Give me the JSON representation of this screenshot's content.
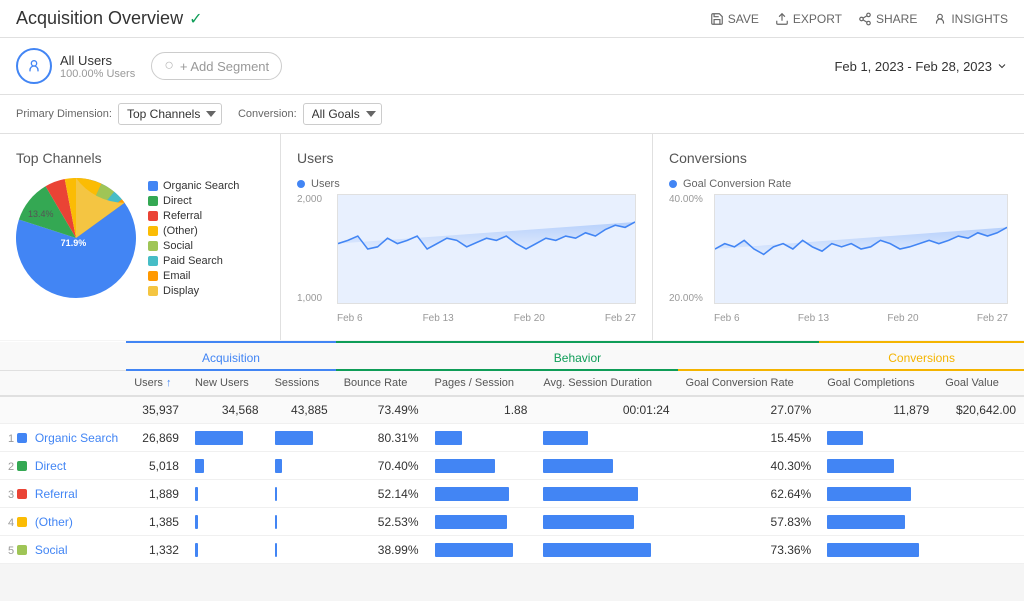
{
  "header": {
    "title": "Acquisition Overview",
    "verified_icon": "✓",
    "actions": [
      {
        "label": "SAVE",
        "icon": "💾"
      },
      {
        "label": "EXPORT",
        "icon": "↑"
      },
      {
        "label": "SHARE",
        "icon": "⇗"
      },
      {
        "label": "INSIGHTS",
        "icon": "👤"
      }
    ]
  },
  "segment": {
    "name": "All Users",
    "sub": "100.00% Users",
    "add_label": "+ Add Segment"
  },
  "date_range": "Feb 1, 2023 - Feb 28, 2023",
  "controls": {
    "primary_dimension_label": "Primary Dimension:",
    "primary_dimension_value": "Top Channels",
    "conversion_label": "Conversion:",
    "conversion_value": "All Goals"
  },
  "top_channels_chart": {
    "title": "Top Channels",
    "legend": [
      {
        "label": "Organic Search",
        "color": "#4285f4"
      },
      {
        "label": "Direct",
        "color": "#34a853"
      },
      {
        "label": "Referral",
        "color": "#ea4335"
      },
      {
        "label": "(Other)",
        "color": "#fbbc04"
      },
      {
        "label": "Social",
        "color": "#9fc556"
      },
      {
        "label": "Paid Search",
        "color": "#46bdc6"
      },
      {
        "label": "Email",
        "color": "#ff9900"
      },
      {
        "label": "Display",
        "color": "#f4c542"
      }
    ],
    "slices": [
      {
        "label": "Organic Search",
        "pct": 71.9,
        "color": "#4285f4",
        "startAngle": 0,
        "endAngle": 258.8
      },
      {
        "label": "Direct",
        "pct": 9.5,
        "color": "#34a853",
        "startAngle": 258.8,
        "endAngle": 293
      },
      {
        "label": "Referral",
        "pct": 5.5,
        "color": "#ea4335",
        "startAngle": 293,
        "endAngle": 312.8
      },
      {
        "label": "(Other)",
        "pct": 4.1,
        "color": "#fbbc04",
        "startAngle": 312.8,
        "endAngle": 327.6
      },
      {
        "label": "Social",
        "pct": 3.8,
        "color": "#9fc556",
        "startAngle": 327.6,
        "endAngle": 341.3
      },
      {
        "label": "Paid Search",
        "pct": 2.8,
        "color": "#46bdc6",
        "startAngle": 341.3,
        "endAngle": 351.4
      },
      {
        "label": "Email",
        "pct": 1.5,
        "color": "#ff9900",
        "startAngle": 351.4,
        "endAngle": 356.8
      },
      {
        "label": "Display",
        "pct": 0.9,
        "color": "#f4c542",
        "startAngle": 356.8,
        "endAngle": 360
      }
    ],
    "label_71": "71.9%",
    "label_13": "13.4%"
  },
  "users_chart": {
    "title": "Users",
    "metric_label": "Users",
    "metric_color": "#4285f4",
    "y_max": "2,000",
    "y_min": "1,000",
    "x_labels": [
      "Feb 6",
      "Feb 13",
      "Feb 20",
      "Feb 27"
    ]
  },
  "conversions_chart": {
    "title": "Conversions",
    "metric_label": "Goal Conversion Rate",
    "metric_color": "#4285f4",
    "y_max": "40.00%",
    "y_min": "20.00%",
    "x_labels": [
      "Feb 6",
      "Feb 13",
      "Feb 20",
      "Feb 27"
    ]
  },
  "table": {
    "groups": [
      {
        "label": "Acquisition",
        "colspan": 3
      },
      {
        "label": "Behavior",
        "colspan": 4
      },
      {
        "label": "Conversions",
        "colspan": 3
      }
    ],
    "columns": [
      {
        "label": "Users",
        "sortable": true,
        "group": "acquisition"
      },
      {
        "label": "New Users",
        "sortable": true,
        "group": "acquisition"
      },
      {
        "label": "Sessions",
        "sortable": true,
        "group": "acquisition"
      },
      {
        "label": "Bounce Rate",
        "sortable": true,
        "group": "behavior"
      },
      {
        "label": "Pages / Session",
        "sortable": true,
        "group": "behavior"
      },
      {
        "label": "Avg. Session Duration",
        "sortable": true,
        "group": "behavior"
      },
      {
        "label": "Goal Conversion Rate",
        "sortable": true,
        "group": "conversions"
      },
      {
        "label": "Goal Completions",
        "sortable": true,
        "group": "conversions"
      },
      {
        "label": "Goal Value",
        "sortable": true,
        "group": "conversions"
      }
    ],
    "total_row": {
      "users": "35,937",
      "new_users": "34,568",
      "sessions": "43,885",
      "bounce_rate": "73.49%",
      "pages_session": "1.88",
      "avg_duration": "00:01:24",
      "goal_conv_rate": "27.07%",
      "goal_completions": "11,879",
      "goal_value": "$20,642.00"
    },
    "rows": [
      {
        "rank": "1",
        "channel": "Organic Search",
        "color": "#4285f4",
        "users": "26,869",
        "users_bar_pct": 74,
        "new_users": "",
        "new_users_bar_pct": 75,
        "sessions": "",
        "bounce_rate": "80.31%",
        "bounce_bar_pct": 80,
        "pages_session": "",
        "pages_bar_pct": 30,
        "avg_duration": "",
        "avg_bar_pct": 35,
        "goal_conv_rate": "15.45%",
        "goal_bar_pct": 20,
        "goal_completions": "",
        "goal_comp_bar_pct": 35,
        "goal_value": ""
      },
      {
        "rank": "2",
        "channel": "Direct",
        "color": "#34a853",
        "users": "5,018",
        "users_bar_pct": 14,
        "new_users": "",
        "new_users_bar_pct": 14,
        "sessions": "",
        "bounce_rate": "70.40%",
        "bounce_bar_pct": 65,
        "pages_session": "",
        "pages_bar_pct": 50,
        "avg_duration": "",
        "avg_bar_pct": 55,
        "goal_conv_rate": "40.30%",
        "goal_bar_pct": 65,
        "goal_completions": "",
        "goal_comp_bar_pct": 55,
        "goal_value": ""
      },
      {
        "rank": "3",
        "channel": "Referral",
        "color": "#ea4335",
        "users": "1,889",
        "users_bar_pct": 5,
        "new_users": "",
        "new_users_bar_pct": 5,
        "sessions": "",
        "bounce_rate": "52.14%",
        "bounce_bar_pct": 50,
        "pages_session": "",
        "pages_bar_pct": 65,
        "avg_duration": "",
        "avg_bar_pct": 70,
        "goal_conv_rate": "62.64%",
        "goal_bar_pct": 82,
        "goal_completions": "",
        "goal_comp_bar_pct": 75,
        "goal_value": ""
      },
      {
        "rank": "4",
        "channel": "(Other)",
        "color": "#fbbc04",
        "users": "1,385",
        "users_bar_pct": 4,
        "new_users": "",
        "new_users_bar_pct": 4,
        "sessions": "",
        "bounce_rate": "52.53%",
        "bounce_bar_pct": 51,
        "pages_session": "",
        "pages_bar_pct": 62,
        "avg_duration": "",
        "avg_bar_pct": 68,
        "goal_conv_rate": "57.83%",
        "goal_bar_pct": 76,
        "goal_completions": "",
        "goal_comp_bar_pct": 70,
        "goal_value": ""
      },
      {
        "rank": "5",
        "channel": "Social",
        "color": "#9fc556",
        "users": "1,332",
        "users_bar_pct": 4,
        "new_users": "",
        "new_users_bar_pct": 4,
        "sessions": "",
        "bounce_rate": "38.99%",
        "bounce_bar_pct": 35,
        "pages_session": "",
        "pages_bar_pct": 75,
        "avg_duration": "",
        "avg_bar_pct": 80,
        "goal_conv_rate": "73.36%",
        "goal_bar_pct": 90,
        "goal_completions": "",
        "goal_comp_bar_pct": 85,
        "goal_value": ""
      }
    ]
  }
}
